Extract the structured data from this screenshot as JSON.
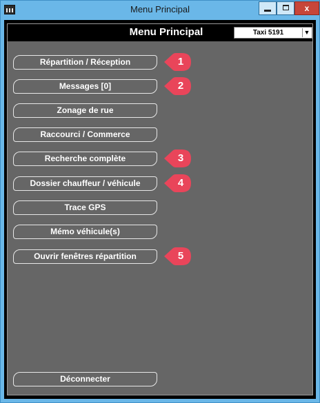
{
  "window": {
    "title": "Menu Principal",
    "close_label": "x"
  },
  "header": {
    "title": "Menu Principal",
    "vehicle_select": "Taxi 5191"
  },
  "menu": [
    {
      "label": "Répartition / Réception",
      "badge": "1"
    },
    {
      "label": "Messages [0]",
      "badge": "2"
    },
    {
      "label": "Zonage de rue",
      "badge": ""
    },
    {
      "label": "Raccourci / Commerce",
      "badge": ""
    },
    {
      "label": "Recherche complète",
      "badge": "3"
    },
    {
      "label": "Dossier chauffeur / véhicule",
      "badge": "4"
    },
    {
      "label": "Trace GPS",
      "badge": ""
    },
    {
      "label": "Mémo véhicule(s)",
      "badge": ""
    },
    {
      "label": "Ouvrir fenêtres répartition",
      "badge": "5"
    }
  ],
  "footer": {
    "logout_label": "Déconnecter"
  },
  "colors": {
    "badge": "#e9455a",
    "panel": "#666666",
    "titlebar": "#6ab7e8"
  }
}
